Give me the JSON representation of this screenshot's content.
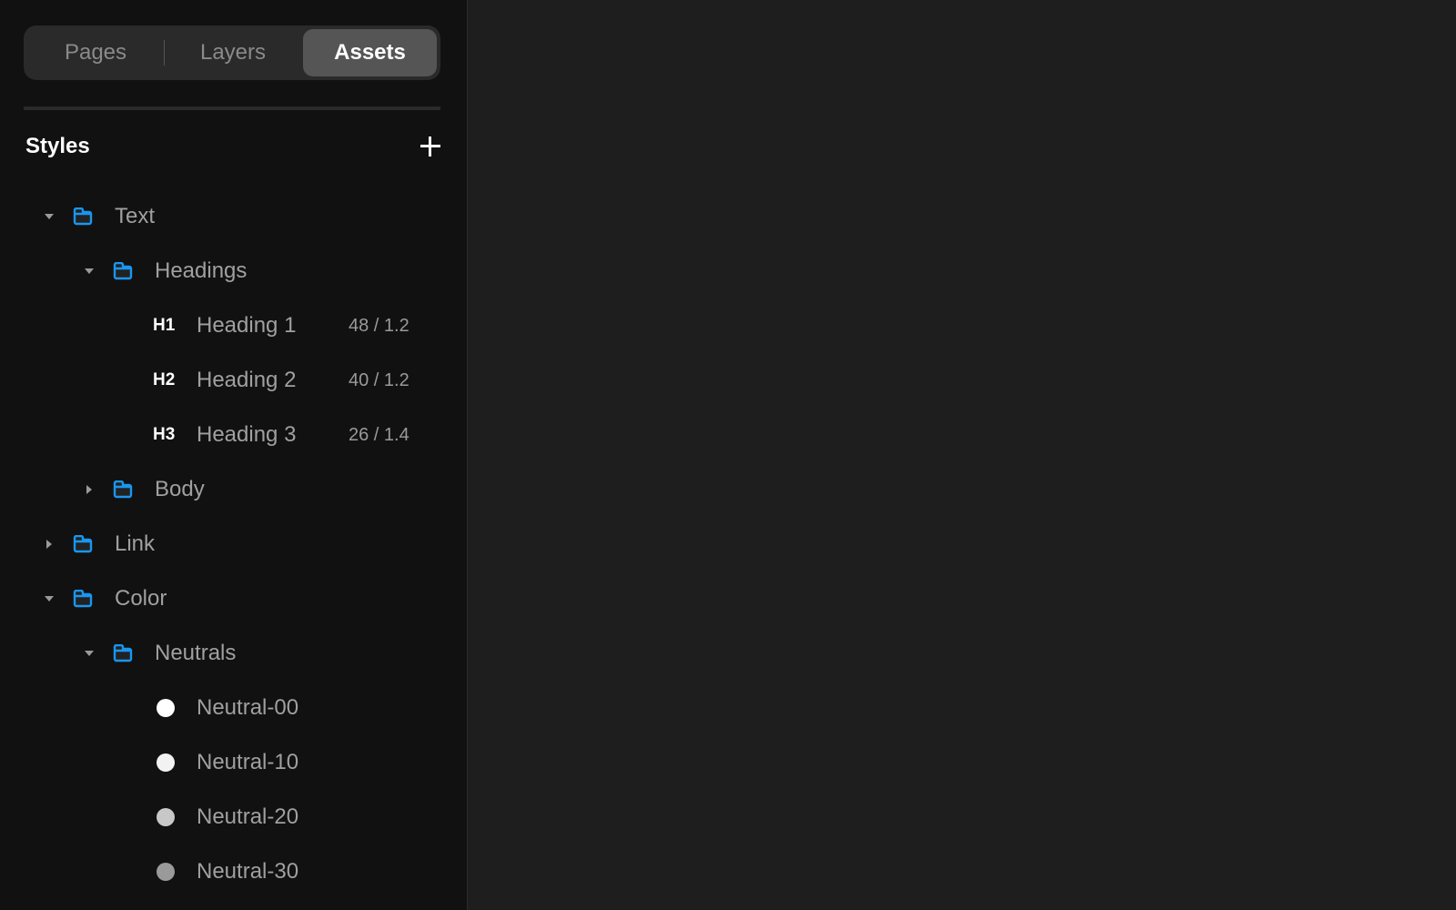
{
  "tabs": {
    "items": [
      {
        "label": "Pages",
        "active": false
      },
      {
        "label": "Layers",
        "active": false
      },
      {
        "label": "Assets",
        "active": true
      }
    ]
  },
  "styles": {
    "title": "Styles",
    "add_icon": "plus-icon"
  },
  "tree": {
    "text": {
      "label": "Text",
      "expanded": true
    },
    "headings": {
      "label": "Headings",
      "expanded": true
    },
    "heading_items": [
      {
        "tag": "H1",
        "label": "Heading 1",
        "meta": "48 / 1.2"
      },
      {
        "tag": "H2",
        "label": "Heading 2",
        "meta": "40 / 1.2"
      },
      {
        "tag": "H3",
        "label": "Heading 3",
        "meta": "26 / 1.4"
      }
    ],
    "body": {
      "label": "Body",
      "expanded": false
    },
    "link": {
      "label": "Link",
      "expanded": false
    },
    "color": {
      "label": "Color",
      "expanded": true
    },
    "neutrals": {
      "label": "Neutrals",
      "expanded": true
    },
    "color_items": [
      {
        "label": "Neutral-00",
        "color": "#ffffff"
      },
      {
        "label": "Neutral-10",
        "color": "#f2f2f2"
      },
      {
        "label": "Neutral-20",
        "color": "#c8c8c8"
      },
      {
        "label": "Neutral-30",
        "color": "#9a9a9a"
      }
    ]
  },
  "colors": {
    "folder_accent": "#1a96f0"
  }
}
